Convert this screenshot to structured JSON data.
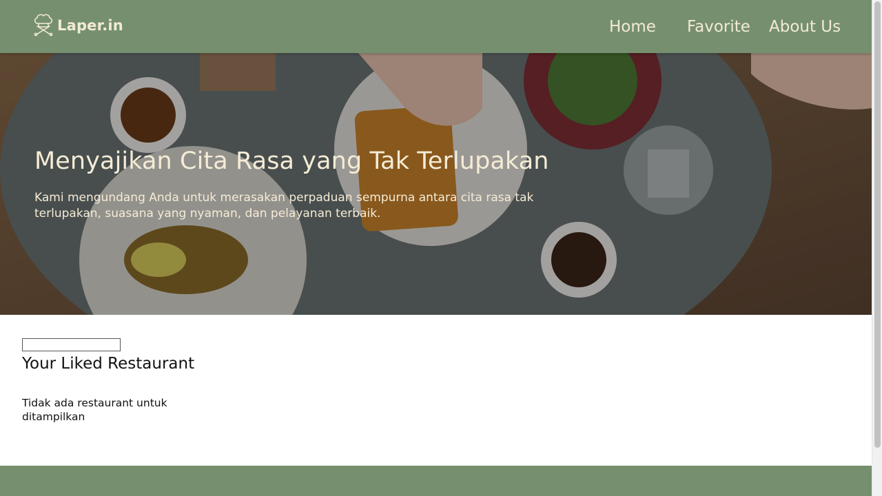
{
  "header": {
    "logo_text": "Laper.in",
    "logo_icon": "chef-hat-icon",
    "nav": [
      {
        "label": "Home"
      },
      {
        "label": "Favorite"
      },
      {
        "label": "About Us"
      }
    ]
  },
  "hero": {
    "title": "Menyajikan Cita Rasa yang Tak Terlupakan",
    "subtitle": "Kami mengundang Anda untuk merasakan perpaduan sempurna antara cita rasa tak terlupakan, suasana yang nyaman, dan pelayanan terbaik."
  },
  "main": {
    "search_value": "",
    "section_title": "Your Liked Restaurant",
    "empty_message": "Tidak ada restaurant untuk ditampilkan"
  },
  "colors": {
    "header_bg": "#76906f",
    "header_text": "#f2ead4",
    "footer_bg": "#76906f"
  }
}
